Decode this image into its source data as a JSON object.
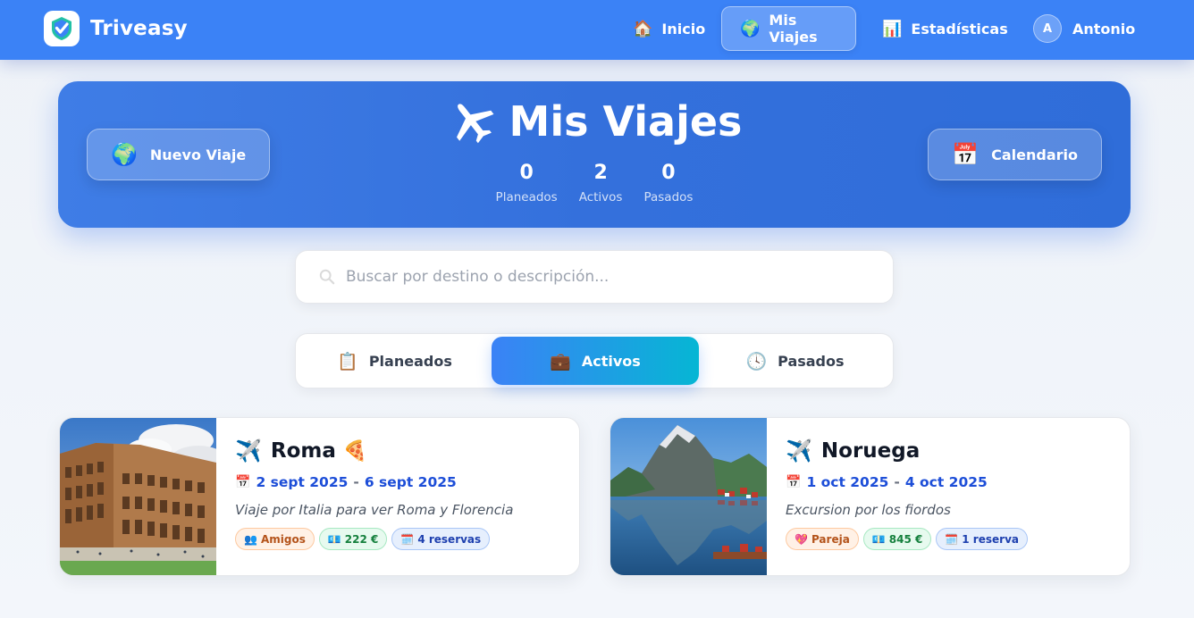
{
  "nav": {
    "brand": "Triveasy",
    "items": [
      {
        "label": "Inicio",
        "icon": "🏠"
      },
      {
        "label": "Mis Viajes",
        "icon": "🌍",
        "active": true
      },
      {
        "label": "Estadísticas",
        "icon": "📊"
      }
    ],
    "user": {
      "initial": "A",
      "name": "Antonio"
    }
  },
  "hero": {
    "title": "Mis Viajes",
    "new_trip_label": "Nuevo Viaje",
    "new_trip_icon": "🌍",
    "calendar_label": "Calendario",
    "calendar_icon": "📅",
    "stats": [
      {
        "value": "0",
        "label": "Planeados"
      },
      {
        "value": "2",
        "label": "Activos"
      },
      {
        "value": "0",
        "label": "Pasados"
      }
    ]
  },
  "search": {
    "placeholder": "Buscar por destino o descripción..."
  },
  "tabs": [
    {
      "label": "Planeados",
      "icon": "📋"
    },
    {
      "label": "Activos",
      "icon": "💼",
      "active": true
    },
    {
      "label": "Pasados",
      "icon": "🕓"
    }
  ],
  "trips": [
    {
      "icon": "✈️",
      "title": "Roma",
      "title_suffix": "🍕",
      "date_icon": "📅",
      "start": "2 sept 2025",
      "end": "6 sept 2025",
      "description": "Viaje por Italia para ver Roma y Florencia",
      "badges": [
        {
          "icon": "👥",
          "text": "Amigos"
        },
        {
          "icon": "💶",
          "text": "222 €"
        },
        {
          "icon": "🗓️",
          "text": "4 reservas"
        }
      ]
    },
    {
      "icon": "✈️",
      "title": "Noruega",
      "title_suffix": "",
      "date_icon": "📅",
      "start": "1 oct 2025",
      "end": "4 oct 2025",
      "description": "Excursion por los fiordos",
      "badges": [
        {
          "icon": "💖",
          "text": "Pareja"
        },
        {
          "icon": "💶",
          "text": "845 €"
        },
        {
          "icon": "🗓️",
          "text": "1 reserva"
        }
      ]
    }
  ],
  "date_separator": "-"
}
